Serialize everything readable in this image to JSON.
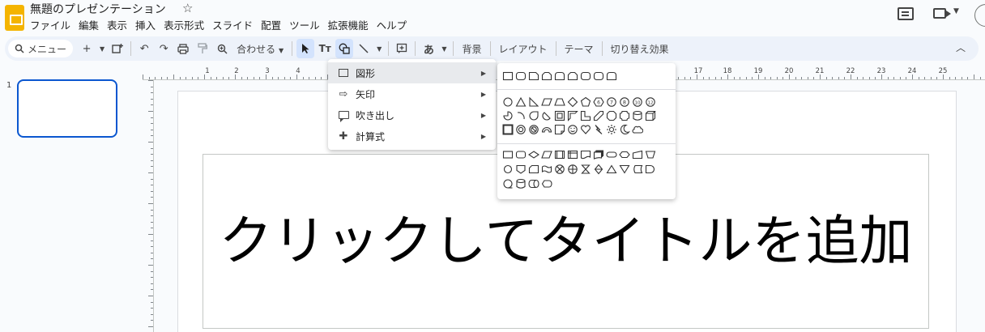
{
  "app": {
    "title": "無題のプレゼンテーション",
    "star_icon": "star-icon",
    "logo_icon": "slides-logo-icon"
  },
  "menubar": [
    "ファイル",
    "編集",
    "表示",
    "挿入",
    "表示形式",
    "スライド",
    "配置",
    "ツール",
    "拡張機能",
    "ヘルプ"
  ],
  "toolbar": {
    "search_label": "メニュー",
    "fit_label": "合わせる",
    "text_icon_label": "Tт",
    "ime_label": "あ",
    "background_label": "背景",
    "layout_label": "レイアウト",
    "theme_label": "テーマ",
    "transition_label": "切り替え効果"
  },
  "filmstrip": {
    "slide_number": "1"
  },
  "ruler": {
    "labels": [
      "1",
      "2",
      "3",
      "4",
      "17",
      "18",
      "19",
      "20",
      "21",
      "22",
      "23",
      "24",
      "25"
    ]
  },
  "slide": {
    "title_placeholder": "クリックしてタイトルを追加"
  },
  "insert_menu": {
    "items": [
      {
        "label": "図形",
        "icon": "shape-icon",
        "highlighted": true
      },
      {
        "label": "矢印",
        "icon": "arrow-icon"
      },
      {
        "label": "吹き出し",
        "icon": "callout-icon"
      },
      {
        "label": "計算式",
        "icon": "equation-icon"
      }
    ]
  },
  "shapes_menu": {
    "sections": [
      "shapes",
      "symbols",
      "flowchart"
    ]
  },
  "colors": {
    "accent": "#0b57d0",
    "toolbar_bg": "#edf2fa",
    "active_tool": "#d3e3fd",
    "logo": "#f4b400"
  }
}
